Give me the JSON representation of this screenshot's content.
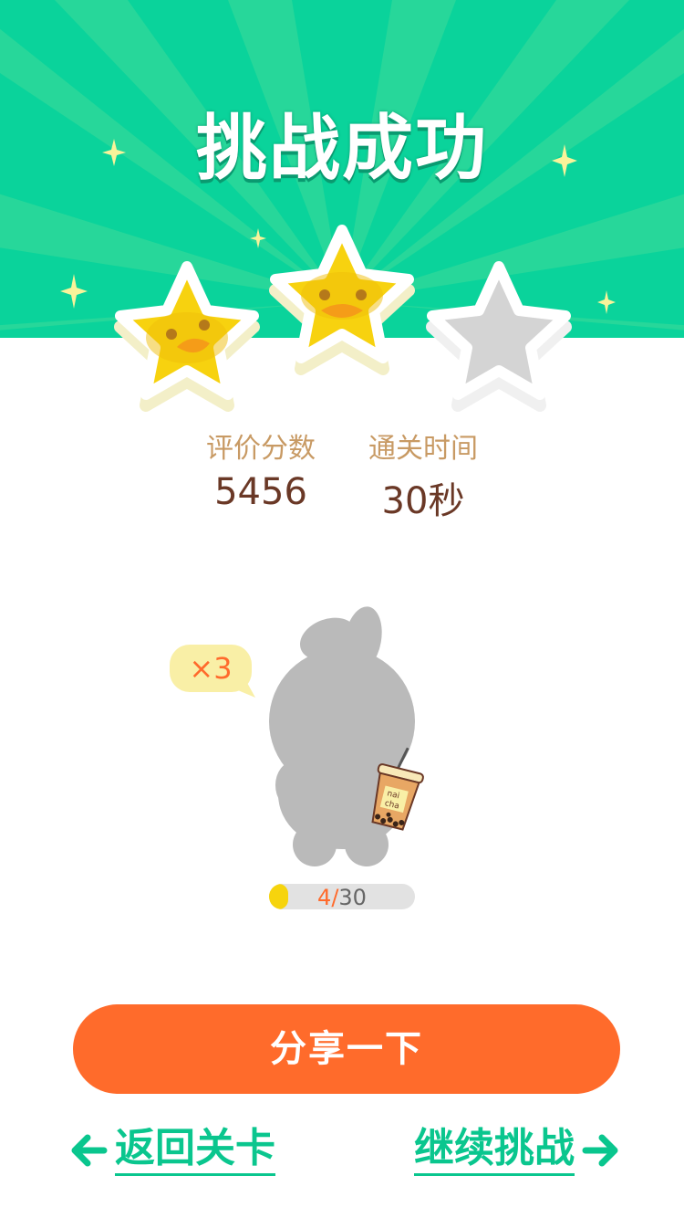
{
  "header": {
    "title": "挑战成功",
    "bg_color": "#0ad39b"
  },
  "rating": {
    "stars_earned": 2,
    "stars_total": 3
  },
  "stats": {
    "score_label": "评价分数",
    "score_value": "5456",
    "time_label": "通关时间",
    "time_value": "30秒"
  },
  "reward": {
    "multiplier": "×3",
    "cup_text_1": "nai",
    "cup_text_2": "cha",
    "progress_current": "4/",
    "progress_total": "30",
    "progress_fraction": 0.133
  },
  "actions": {
    "share_label": "分享一下",
    "back_label": "返回关卡",
    "continue_label": "继续挑战"
  },
  "colors": {
    "primary": "#0ad39b",
    "accent": "#ff6b2b",
    "star": "#f7d20f",
    "star_empty": "#d4d4d4"
  }
}
